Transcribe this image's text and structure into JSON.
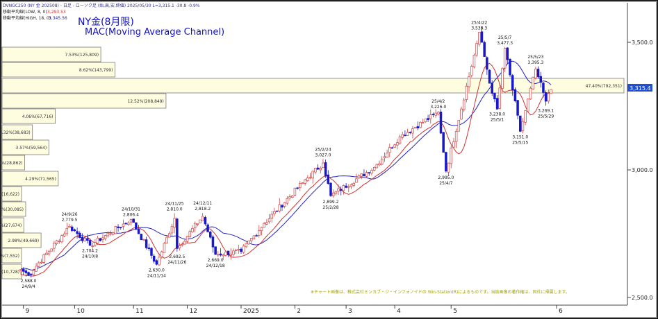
{
  "header": {
    "line1": "DVNGC250 (NY 金 202508) - 日足 - ローソク足 (始,高,安,終値) 2025/05/30 L=3,315.1 -30.8 -0.9%",
    "line2_label": "移動平均線(LOW, 8, 0)",
    "line2_value": "3,293.53",
    "line3_label": "移動平均線(HIGH, 18, 0)",
    "line3_value": "3,345.56"
  },
  "title": {
    "main": "NY金(8月限)",
    "sub": "MAC(Moving Average Channel)"
  },
  "copyright": "※チャート画像は、株式会社ミンカブ・ジ・インフォノイドの Win-Station(R)によるものです。当該画像の著作権は、同社に帰属します。",
  "price_label": "3,315.4",
  "colors": {
    "up_candle": "#d04040",
    "down_candle": "#1818c8",
    "ma_low": "#d03030",
    "ma_high": "#2020c0",
    "volume_profile_fill": "#fffde0",
    "volume_profile_stroke": "#7a7a7a",
    "price_tag_bg": "#2050d0"
  },
  "chart_data": {
    "type": "candlestick",
    "yaxis": {
      "min": 2500,
      "max": 3700,
      "ticks": [
        "2,500.0",
        "3,000.0",
        "3,500.0"
      ],
      "tick_values": [
        2500,
        3000,
        3500
      ]
    },
    "xaxis": {
      "labels": [
        "9",
        "10",
        "11",
        "12",
        "2025",
        "2",
        "3",
        "4",
        "5",
        "6"
      ]
    },
    "series": [
      {
        "name": "移動平均線(LOW, 8, 0)",
        "last": 3293.53
      },
      {
        "name": "移動平均線(HIGH, 18, 0)",
        "last": 3345.56
      }
    ],
    "volume_profile": [
      {
        "price": 3550,
        "label": "7.53%(125,809)"
      },
      {
        "price": 3450,
        "label": "8.62%(143,799)"
      },
      {
        "price": 3350,
        "label": "47.40%(792,351)"
      },
      {
        "price": 3250,
        "label": "12.52%(208,849)"
      },
      {
        "price": 3150,
        "label": "4.06%(67,716)"
      },
      {
        "price": 3050,
        "label": "2.32%(38,683)"
      },
      {
        "price": 2950,
        "label": "3.57%(59,564)"
      },
      {
        "price": 2850,
        "label": "1.73%(28,862)"
      },
      {
        "price": 2750,
        "label": "4.29%(71,565)"
      },
      {
        "price": 2650,
        "label": "1.00%(16,622)"
      },
      {
        "price": 2550,
        "label": "1.80%(30,085)"
      },
      {
        "price": 2450,
        "label": "1.66%(27,674)"
      },
      {
        "price": 2350,
        "label": "2.98%(49,669)"
      },
      {
        "price": 2250,
        "label": "0.45%(7,552)"
      },
      {
        "price": 2150,
        "label": "0.64%(10,728)"
      }
    ],
    "annotations": [
      {
        "date": "24/9/4",
        "value": "2,588.0",
        "kind": "low"
      },
      {
        "date": "24/9/26",
        "value": "2,779.5",
        "kind": "high"
      },
      {
        "date": "24/10/8",
        "value": "2,704.2",
        "kind": "low"
      },
      {
        "date": "24/10/31",
        "value": "2,806.4",
        "kind": "high"
      },
      {
        "date": "24/11/14",
        "value": "2,630.0",
        "kind": "low"
      },
      {
        "date": "24/11/25",
        "value": "2,810.0",
        "kind": "high"
      },
      {
        "date": "24/11/26",
        "value": "2,692.5",
        "kind": "low"
      },
      {
        "date": "24/12/11",
        "value": "2,818.2",
        "kind": "high"
      },
      {
        "date": "24/12/18",
        "value": "2,669.0",
        "kind": "low"
      },
      {
        "date": "25/2/24",
        "value": "3,027.0",
        "kind": "high"
      },
      {
        "date": "25/2/28",
        "value": "2,899.2",
        "kind": "low"
      },
      {
        "date": "25/4/2",
        "value": "3,226.0",
        "kind": "high"
      },
      {
        "date": "25/4/7",
        "value": "2,995.0",
        "kind": "low"
      },
      {
        "date": "25/4/22",
        "value": "3,539.3",
        "kind": "high"
      },
      {
        "date": "25/5/1",
        "value": "3,238.0",
        "kind": "low"
      },
      {
        "date": "25/5/7",
        "value": "3,477.3",
        "kind": "high"
      },
      {
        "date": "25/5/15",
        "value": "3,151.0",
        "kind": "low"
      },
      {
        "date": "25/5/23",
        "value": "3,395.3",
        "kind": "high"
      },
      {
        "date": "25/5/29",
        "value": "3,269.1",
        "kind": "low"
      }
    ],
    "anchors": [
      {
        "i": 0,
        "v": 2610
      },
      {
        "i": 3,
        "v": 2588
      },
      {
        "i": 19,
        "v": 2779
      },
      {
        "i": 27,
        "v": 2704
      },
      {
        "i": 43,
        "v": 2806
      },
      {
        "i": 53,
        "v": 2630
      },
      {
        "i": 60,
        "v": 2810
      },
      {
        "i": 61,
        "v": 2692
      },
      {
        "i": 71,
        "v": 2818
      },
      {
        "i": 76,
        "v": 2669
      },
      {
        "i": 86,
        "v": 2680
      },
      {
        "i": 95,
        "v": 2790
      },
      {
        "i": 110,
        "v": 2950
      },
      {
        "i": 118,
        "v": 3027
      },
      {
        "i": 121,
        "v": 2899
      },
      {
        "i": 138,
        "v": 3010
      },
      {
        "i": 148,
        "v": 3130
      },
      {
        "i": 163,
        "v": 3226
      },
      {
        "i": 166,
        "v": 2995
      },
      {
        "i": 177,
        "v": 3450
      },
      {
        "i": 179,
        "v": 3539
      },
      {
        "i": 184,
        "v": 3300
      },
      {
        "i": 186,
        "v": 3238
      },
      {
        "i": 189,
        "v": 3477
      },
      {
        "i": 195,
        "v": 3151
      },
      {
        "i": 201,
        "v": 3395
      },
      {
        "i": 205,
        "v": 3269
      },
      {
        "i": 207,
        "v": 3315
      }
    ]
  }
}
